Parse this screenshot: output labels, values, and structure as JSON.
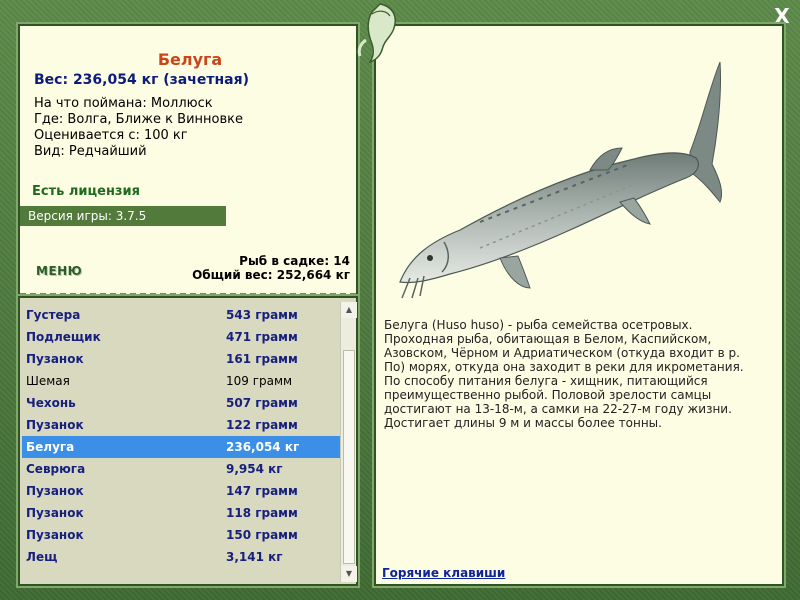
{
  "window": {
    "close_label": "X"
  },
  "fish": {
    "name": "Белуга",
    "weight_line": "Вес: 236,054 кг (зачетная)",
    "caught_on": "На что поймана: Моллюск",
    "location": "Где: Волга, Ближе к Винновке",
    "value": "Оценивается с: 100 кг",
    "kind": "Вид: Редчайший"
  },
  "license_text": "Есть лицензия",
  "version_text": "Версия игры: 3.7.5",
  "menu_label": "МЕНЮ",
  "keep_net": {
    "count": "Рыб в садке: 14",
    "total": "Общий вес: 252,664 кг"
  },
  "catch_list": [
    {
      "name": "Густера",
      "weight": "543 грамм"
    },
    {
      "name": "Подлещик",
      "weight": "471 грамм"
    },
    {
      "name": "Пузанок",
      "weight": "161 грамм"
    },
    {
      "name": "Шемая",
      "weight": "109 грамм"
    },
    {
      "name": "Чехонь",
      "weight": "507 грамм"
    },
    {
      "name": "Пузанок",
      "weight": "122 грамм"
    },
    {
      "name": "Белуга",
      "weight": "236,054 кг"
    },
    {
      "name": "Севрюга",
      "weight": "9,954 кг"
    },
    {
      "name": "Пузанок",
      "weight": "147 грамм"
    },
    {
      "name": "Пузанок",
      "weight": "118 грамм"
    },
    {
      "name": "Пузанок",
      "weight": "150 грамм"
    },
    {
      "name": "Лещ",
      "weight": "3,141 кг"
    }
  ],
  "description": "Белуга (Huso huso) - рыба семейства осетровых. Проходная рыба, обитающая в Белом, Каспийском, Азовском, Чёрном и Адриатическом (откуда входит в р. По) морях, откуда она заходит в реки для икрометания. По способу питания белуга - хищник, питающийся преимущественно рыбой. Половой зрелости самцы достигают на 13-18-м, а самки на 22-27-м году жизни. Достигает длины 9 м и массы более тонны.",
  "hotkeys_label": "Горячие клавиши",
  "colors": {
    "frame": "#4d7a3e",
    "panel": "#fdfde3",
    "title": "#c8461a",
    "accent_blue": "#0c1c7a",
    "selection": "#3c8fe6",
    "version_bar": "#527a3a"
  }
}
